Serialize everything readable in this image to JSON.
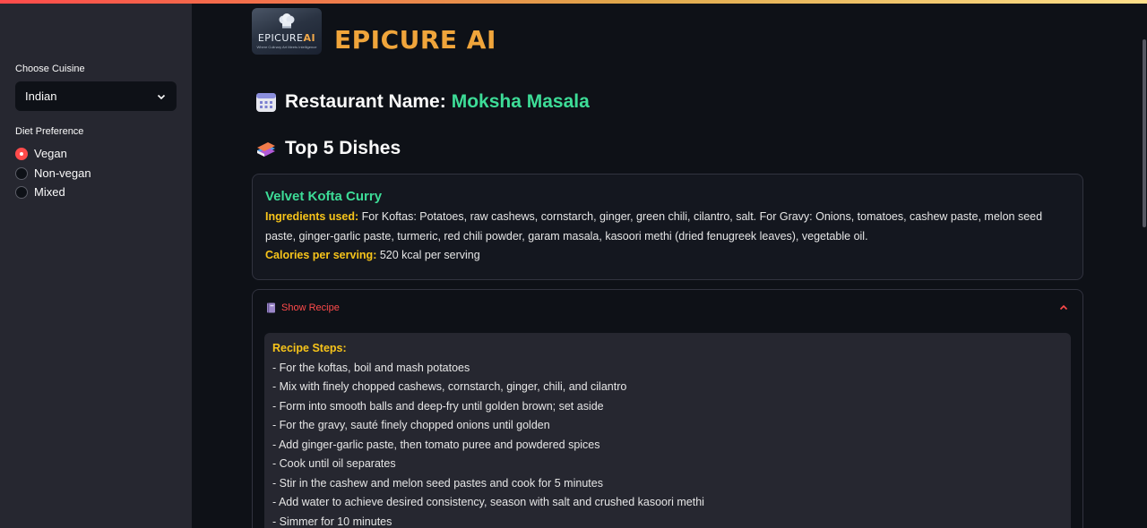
{
  "sidebar": {
    "cuisine_label": "Choose Cuisine",
    "cuisine_value": "Indian",
    "diet_label": "Diet Preference",
    "diet_options": [
      "Vegan",
      "Non-vegan",
      "Mixed"
    ],
    "diet_selected": "Vegan"
  },
  "header": {
    "logo_text_a": "EPICURE",
    "logo_text_b": "AI",
    "logo_tagline": "Where Culinary Art Meets Intelligence",
    "app_title": "EPICURE AI"
  },
  "restaurant": {
    "label": "Restaurant Name:",
    "name": "Moksha Masala"
  },
  "dishes_heading": "Top 5 Dishes",
  "dish": {
    "name": "Velvet Kofta Curry",
    "ingredients_label": "Ingredients used:",
    "ingredients": "For Koftas: Potatoes, raw cashews, cornstarch, ginger, green chili, cilantro, salt. For Gravy: Onions, tomatoes, cashew paste, melon seed paste, ginger-garlic paste, turmeric, red chili powder, garam masala, kasoori methi (dried fenugreek leaves), vegetable oil.",
    "calories_label": "Calories per serving:",
    "calories": "520 kcal per serving"
  },
  "recipe": {
    "toggle_label": "Show Recipe",
    "steps_label": "Recipe Steps:",
    "steps": [
      "- For the koftas, boil and mash potatoes",
      "- Mix with finely chopped cashews, cornstarch, ginger, chili, and cilantro",
      "- Form into smooth balls and deep-fry until golden brown; set aside",
      "- For the gravy, sauté finely chopped onions until golden",
      "- Add ginger-garlic paste, then tomato puree and powdered spices",
      "- Cook until oil separates",
      "- Stir in the cashew and melon seed pastes and cook for 5 minutes",
      "- Add water to achieve desired consistency, season with salt and crushed kasoori methi",
      "- Simmer for 10 minutes"
    ]
  },
  "colors": {
    "accent_red": "#ff4b4b",
    "title_orange": "#f0a53b",
    "dish_green": "#3ddc97",
    "label_yellow": "#f7c41a"
  }
}
